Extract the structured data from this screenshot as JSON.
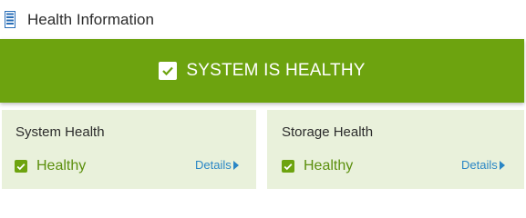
{
  "header": {
    "title": "Health Information",
    "icon": "server-icon"
  },
  "banner": {
    "text": "SYSTEM IS HEALTHY",
    "icon": "check-icon",
    "color": "#6da30f"
  },
  "cards": [
    {
      "title": "System Health",
      "status": "Healthy",
      "details_label": "Details"
    },
    {
      "title": "Storage Health",
      "status": "Healthy",
      "details_label": "Details"
    }
  ],
  "colors": {
    "accent_green": "#6da30f",
    "status_text": "#5b8f0c",
    "card_bg": "#e9f1db",
    "link": "#2a86c5"
  }
}
